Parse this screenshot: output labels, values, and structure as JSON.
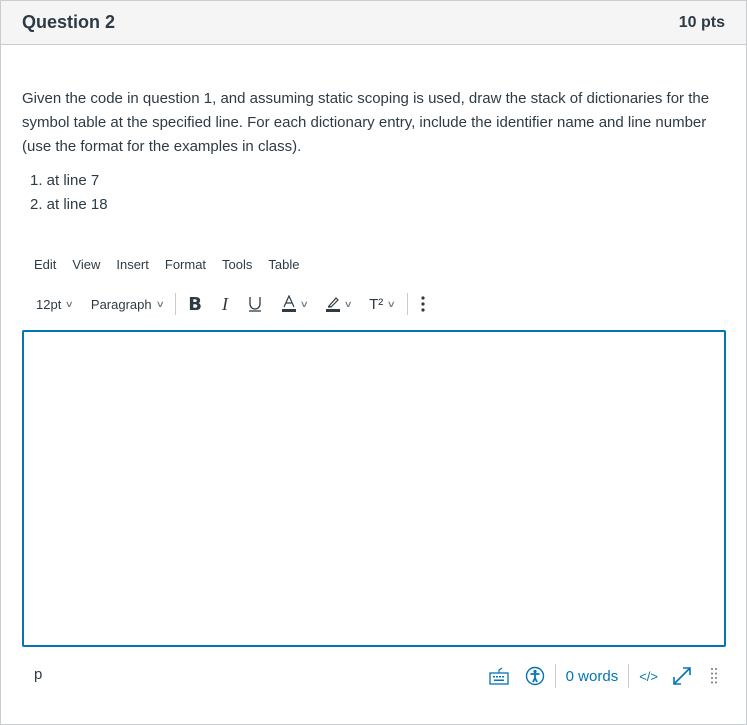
{
  "question": {
    "title": "Question 2",
    "points": "10 pts",
    "prompt": "Given the code in question 1, and assuming static scoping is used, draw the stack of dictionaries for the symbol table at the specified line. For each dictionary entry, include the identifier name and line number (use the format for the examples in class).",
    "items": [
      "1. at line 7",
      "2. at line 18"
    ]
  },
  "editor": {
    "menu": [
      "Edit",
      "View",
      "Insert",
      "Format",
      "Tools",
      "Table"
    ],
    "font_size": "12pt",
    "block_format": "Paragraph",
    "formatting": {
      "bold": "B",
      "italic": "I",
      "underline": "U",
      "text_color": "A",
      "superscript": "T²"
    },
    "content": "",
    "status": {
      "path": "p",
      "word_count": "0 words",
      "html_toggle": "</>"
    },
    "accent_color": "#0374b5"
  }
}
